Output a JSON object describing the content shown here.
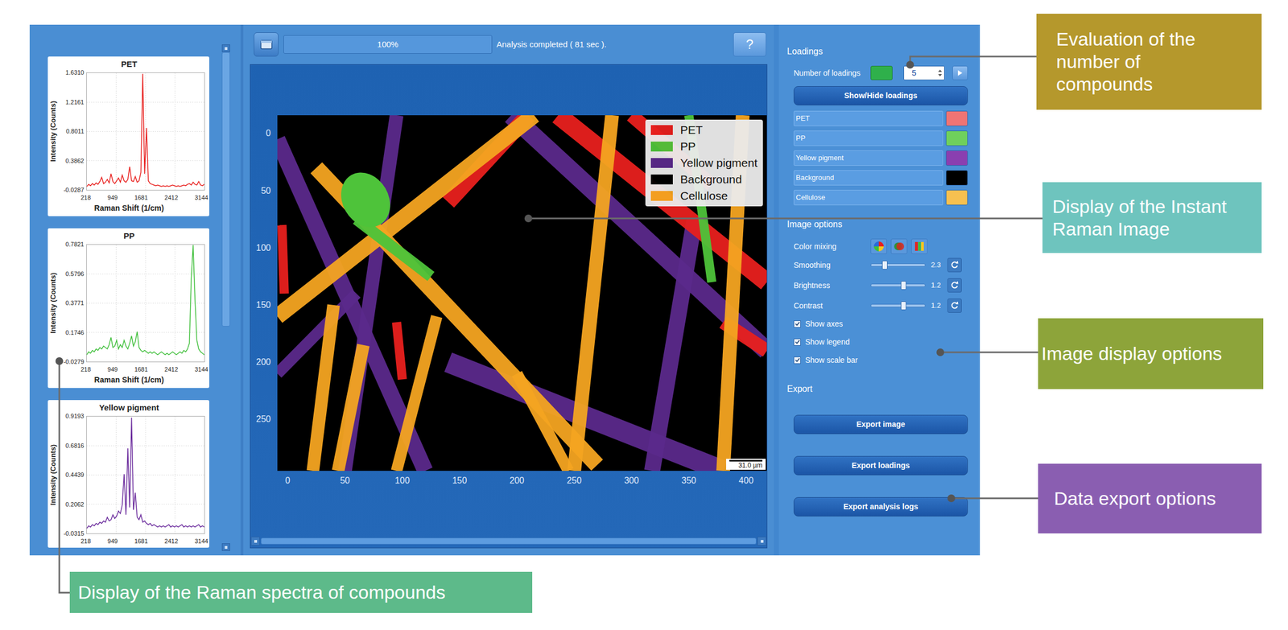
{
  "spectra": [
    {
      "title": "PET",
      "color": "#e8201e",
      "y_label": "Intensity (Counts)",
      "x_label": "Raman Shift (1/cm)",
      "y_ticks": [
        "1.6310",
        "1.2161",
        "0.8011",
        "0.3862",
        "-0.0287"
      ],
      "y_range": [
        -0.0287,
        1.631
      ],
      "x_ticks": [
        "218",
        "949",
        "1681",
        "2412",
        "3144"
      ],
      "values": [
        0.02,
        0.05,
        0.03,
        0.06,
        0.04,
        0.07,
        0.05,
        0.09,
        0.15,
        0.06,
        0.08,
        0.12,
        0.07,
        0.2,
        0.09,
        0.06,
        0.1,
        0.14,
        0.08,
        0.18,
        0.1,
        0.08,
        0.12,
        0.3,
        0.1,
        0.09,
        0.16,
        0.08,
        0.1,
        0.22,
        1.62,
        0.2,
        0.85,
        0.1,
        0.06,
        0.05,
        0.04,
        0.03,
        0.04,
        0.03,
        0.02,
        0.03,
        0.02,
        0.03,
        0.02,
        0.03,
        0.04,
        0.03,
        0.02,
        0.03,
        0.02,
        0.03,
        0.04,
        0.03,
        0.05,
        0.06,
        0.04,
        0.08,
        0.05,
        0.04,
        0.09,
        0.04,
        0.03,
        0.05
      ]
    },
    {
      "title": "PP",
      "color": "#3fbf3a",
      "y_label": "Intensity (Counts)",
      "x_label": "Raman Shift (1/cm)",
      "y_ticks": [
        "0.7821",
        "0.5796",
        "0.3771",
        "0.1746",
        "-0.0279"
      ],
      "y_range": [
        -0.0279,
        0.7821
      ],
      "x_ticks": [
        "218",
        "949",
        "1681",
        "2412",
        "3144"
      ],
      "values": [
        0.02,
        0.04,
        0.03,
        0.05,
        0.04,
        0.06,
        0.05,
        0.07,
        0.06,
        0.08,
        0.07,
        0.06,
        0.09,
        0.14,
        0.07,
        0.08,
        0.12,
        0.06,
        0.09,
        0.07,
        0.12,
        0.08,
        0.06,
        0.1,
        0.15,
        0.08,
        0.11,
        0.18,
        0.07,
        0.05,
        0.04,
        0.05,
        0.04,
        0.03,
        0.04,
        0.03,
        0.04,
        0.03,
        0.02,
        0.03,
        0.04,
        0.03,
        0.02,
        0.03,
        0.02,
        0.03,
        0.04,
        0.03,
        0.02,
        0.03,
        0.04,
        0.03,
        0.05,
        0.04,
        0.06,
        0.1,
        0.55,
        0.78,
        0.4,
        0.12,
        0.06,
        0.04,
        0.03,
        0.02
      ]
    },
    {
      "title": "Yellow pigment",
      "color": "#6a2a9c",
      "y_label": "Intensity (Counts)",
      "y_ticks": [
        "0.9193",
        "0.6816",
        "0.4439",
        "0.2062",
        "-0.0315"
      ],
      "y_range": [
        -0.0315,
        0.9193
      ],
      "x_ticks": [
        "218",
        "949",
        "1681",
        "2412",
        "3144"
      ],
      "values": [
        0.01,
        0.03,
        0.02,
        0.04,
        0.03,
        0.05,
        0.04,
        0.06,
        0.05,
        0.07,
        0.06,
        0.1,
        0.07,
        0.08,
        0.12,
        0.09,
        0.11,
        0.15,
        0.13,
        0.2,
        0.45,
        0.12,
        0.66,
        0.18,
        0.91,
        0.16,
        0.3,
        0.1,
        0.08,
        0.12,
        0.06,
        0.07,
        0.05,
        0.04,
        0.05,
        0.03,
        0.04,
        0.03,
        0.02,
        0.03,
        0.02,
        0.03,
        0.02,
        0.03,
        0.04,
        0.02,
        0.03,
        0.02,
        0.03,
        0.02,
        0.03,
        0.04,
        0.02,
        0.03,
        0.02,
        0.03,
        0.02,
        0.03,
        0.02,
        0.03,
        0.04,
        0.02,
        0.03,
        0.02
      ]
    }
  ],
  "toolbar": {
    "progress": {
      "label": "100%",
      "level": 1
    },
    "status": "Analysis completed ( 81 sec ).",
    "help": "?"
  },
  "map": {
    "legend": [
      {
        "label": "PET",
        "color": "#e8201e"
      },
      {
        "label": "PP",
        "color": "#4ec33a"
      },
      {
        "label": "Yellow pigment",
        "color": "#5b2a8c"
      },
      {
        "label": "Background",
        "color": "#000000"
      },
      {
        "label": "Cellulose",
        "color": "#f5a521"
      }
    ],
    "x_ticks": [
      "0",
      "50",
      "100",
      "150",
      "200",
      "250",
      "300",
      "350",
      "400"
    ],
    "y_ticks": [
      "0",
      "50",
      "100",
      "150",
      "200",
      "250"
    ],
    "scale_bar": "31.0 µm"
  },
  "loadings": {
    "heading": "Loadings",
    "count_label": "Number of loadings",
    "count": "5",
    "toggle_button": "Show/Hide loadings",
    "items": [
      {
        "label": "PET",
        "color": "#f07474"
      },
      {
        "label": "PP",
        "color": "#6fd05c"
      },
      {
        "label": "Yellow pigment",
        "color": "#8a3fb0"
      },
      {
        "label": "Background",
        "color": "#000000"
      },
      {
        "label": "Cellulose",
        "color": "#f7c050"
      }
    ]
  },
  "image_options": {
    "heading": "Image options",
    "color_mixing_label": "Color mixing",
    "sliders": [
      {
        "label": "Smoothing",
        "level": 0.25,
        "reading": "2.3"
      },
      {
        "label": "Brightness",
        "level": 0.6,
        "reading": "1.2"
      },
      {
        "label": "Contrast",
        "level": 0.6,
        "reading": "1.2"
      }
    ],
    "checkboxes": [
      {
        "label": "Show axes",
        "checked": true
      },
      {
        "label": "Show legend",
        "checked": true
      },
      {
        "label": "Show scale bar",
        "checked": true
      }
    ]
  },
  "export": {
    "heading": "Export",
    "buttons": [
      "Export image",
      "Export loadings",
      "Export analysis logs"
    ]
  },
  "callouts": [
    {
      "text": "Evaluation of the number of compounds",
      "color": "#b5982c"
    },
    {
      "text": "Display of the Instant Raman Image",
      "color": "#6ec4be"
    },
    {
      "text": "Image display options",
      "color": "#8da43a"
    },
    {
      "text": "Data export options",
      "color": "#8a5eb1"
    },
    {
      "text": "Display of the Raman spectra of compounds",
      "color": "#5dba8a"
    }
  ]
}
